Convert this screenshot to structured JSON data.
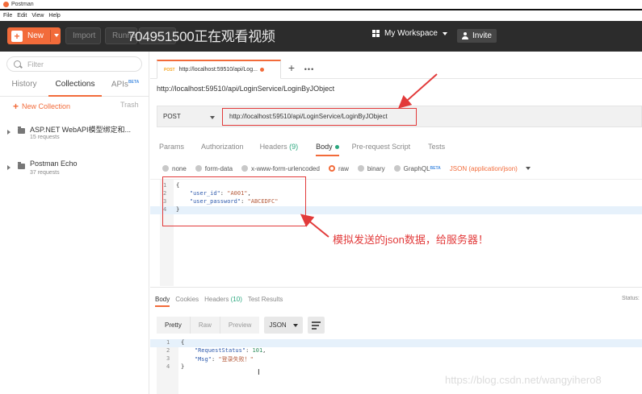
{
  "window": {
    "title": "Postman"
  },
  "menu": [
    "File",
    "Edit",
    "View",
    "Help"
  ],
  "header": {
    "new_label": "New",
    "import_label": "Import",
    "runner_label": "Runner",
    "watermark": "704951500正在观看视频",
    "workspace_label": "My Workspace",
    "invite_label": "Invite"
  },
  "sidebar": {
    "filter_placeholder": "Filter",
    "tabs": [
      {
        "label": "History"
      },
      {
        "label": "Collections"
      },
      {
        "label": "APIs",
        "badge": "BETA"
      }
    ],
    "new_collection": "New Collection",
    "trash": "Trash",
    "collections": [
      {
        "name": "ASP.NET WebAPI模型绑定和...",
        "count": "15 requests"
      },
      {
        "name": "Postman Echo",
        "count": "37 requests"
      }
    ]
  },
  "request": {
    "tab_method": "POST",
    "tab_label": "http://localhost:59510/api/LoginService/LoginByJObject",
    "tab_label_short": "http://localhost:59510/api/Log...",
    "title": "http://localhost:59510/api/LoginService/LoginByJObject",
    "method": "POST",
    "url": "http://localhost:59510/api/LoginService/LoginByJObject",
    "tabs": [
      {
        "label": "Params"
      },
      {
        "label": "Authorization"
      },
      {
        "label": "Headers",
        "count": "(9)"
      },
      {
        "label": "Body"
      },
      {
        "label": "Pre-request Script"
      },
      {
        "label": "Tests"
      }
    ],
    "body_options": [
      "none",
      "form-data",
      "x-www-form-urlencoded",
      "raw",
      "binary",
      "GraphQL"
    ],
    "graphql_badge": "BETA",
    "content_type": "JSON (application/json)",
    "body_lines": [
      {
        "n": "1",
        "text": "{"
      },
      {
        "n": "2",
        "key": "\"user_id\"",
        "val": "\"A001\"",
        "tail": ","
      },
      {
        "n": "3",
        "key": "\"user_password\"",
        "val": "\"ABCEDFC\"",
        "tail": ""
      },
      {
        "n": "4",
        "text": "}"
      }
    ],
    "annotation": "模拟发送的json数据，给服务器！"
  },
  "response": {
    "tabs": [
      {
        "label": "Body"
      },
      {
        "label": "Cookies"
      },
      {
        "label": "Headers",
        "count": "(10)"
      },
      {
        "label": "Test Results"
      }
    ],
    "status_label": "Status:",
    "view_modes": [
      "Pretty",
      "Raw",
      "Preview"
    ],
    "format": "JSON",
    "lines": [
      {
        "n": "1",
        "text": "{"
      },
      {
        "n": "2",
        "key": "\"RequestStatus\"",
        "val": "101",
        "tail": ","
      },
      {
        "n": "3",
        "key": "\"Msg\"",
        "val": "\"登录失败！\"",
        "tail": ""
      },
      {
        "n": "4",
        "text": "}"
      }
    ],
    "watermark": "https://blog.csdn.net/wangyihero8"
  },
  "colors": {
    "accent": "#f26b3a",
    "annotation": "#e23a3a",
    "header_bg": "#2c2c2c",
    "status_green": "#2aa77e"
  }
}
